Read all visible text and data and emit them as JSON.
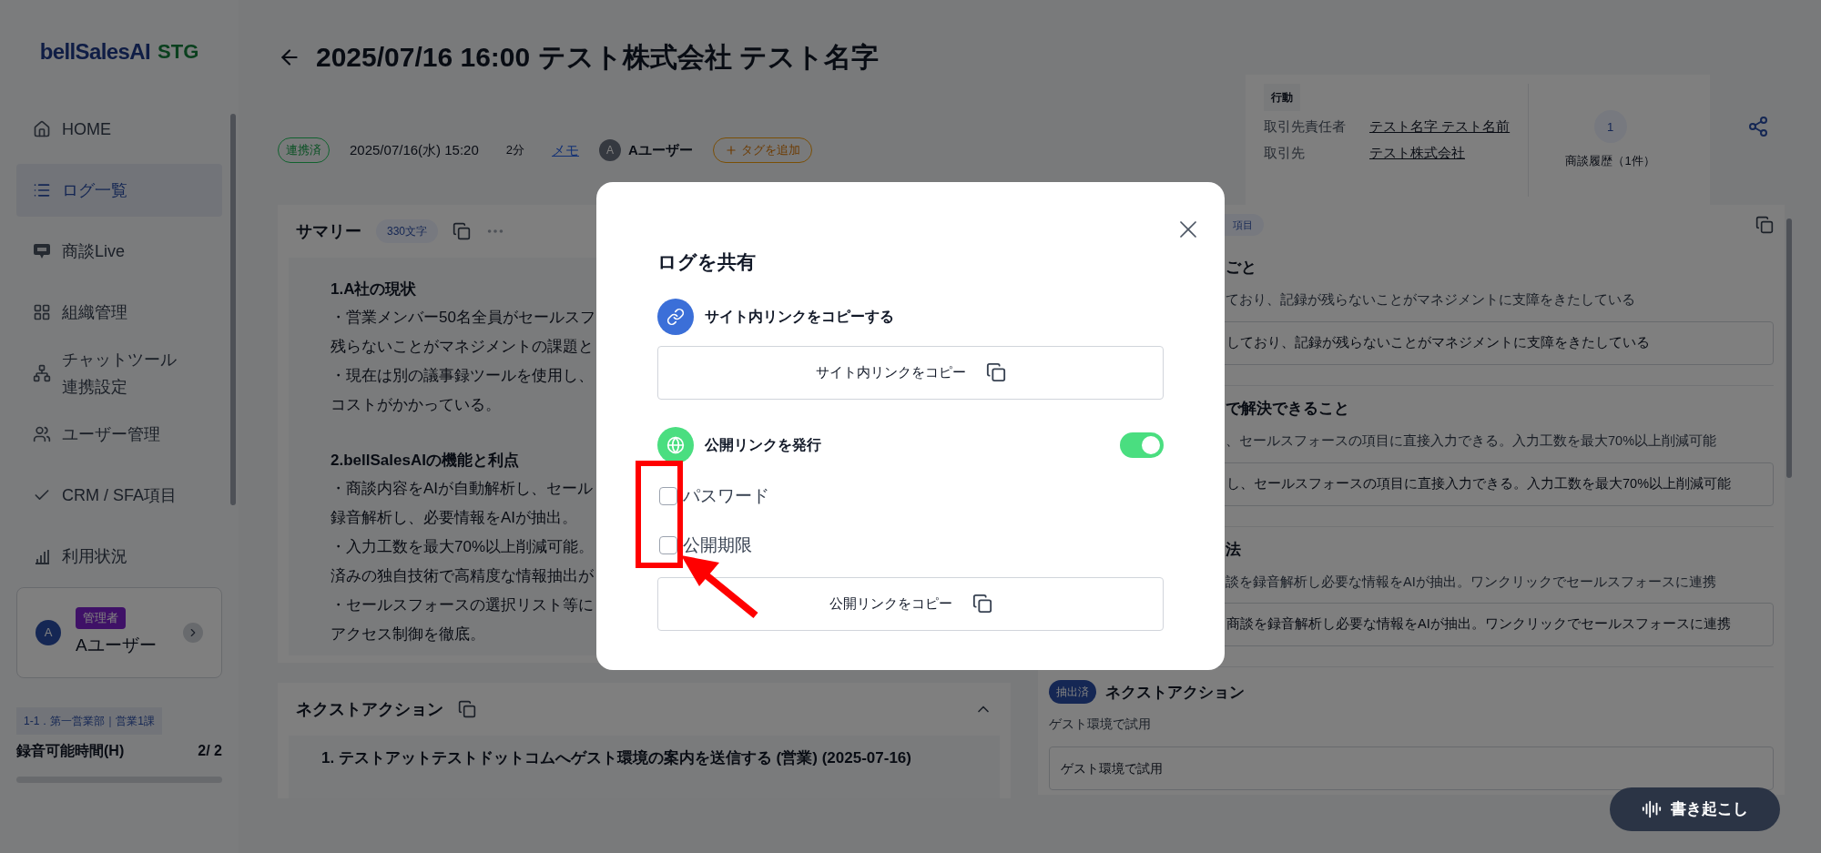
{
  "sidebar": {
    "logo": {
      "brand": "bellSalesAI",
      "env": "STG"
    },
    "nav": [
      {
        "label": "HOME",
        "selected": false
      },
      {
        "label": "ログ一覧",
        "selected": true
      },
      {
        "label": "商談Live",
        "selected": false
      },
      {
        "label": "組織管理",
        "selected": false
      },
      {
        "label": "チャットツール連携設定",
        "selected": false
      },
      {
        "label": "ユーザー管理",
        "selected": false
      },
      {
        "label": "CRM / SFA項目",
        "selected": false
      },
      {
        "label": "利用状況",
        "selected": false
      }
    ],
    "user": {
      "avatar": "A",
      "role": "管理者",
      "name": "Aユーザー"
    },
    "department": "1-1．第一営業部｜営業1課",
    "quota": {
      "label": "録音可能時間(H)",
      "value": "2/ 2"
    }
  },
  "header": {
    "title": "2025/07/16 16:00 テスト株式会社 テスト名字",
    "meta": {
      "status": "連携済",
      "datetime": "2025/07/16(水) 15:20",
      "duration": "2分",
      "memo": "メモ",
      "user_avatar": "A",
      "user": "Aユーザー",
      "add_tag": "タグを追加"
    },
    "info": {
      "tag": "行動",
      "rows": [
        {
          "label": "取引先責任者",
          "value": "テスト名字 テスト名前"
        },
        {
          "label": "取引先",
          "value": "テスト株式会社"
        }
      ],
      "history_count": "1",
      "history_label": "商談履歴（1件）"
    }
  },
  "summary": {
    "title": "サマリー",
    "count": "330文字",
    "lines": [
      {
        "kind": "heading",
        "text": "1.A社の現状"
      },
      {
        "kind": "text",
        "text": "・営業メンバー50名全員がセールスフ"
      },
      {
        "kind": "text",
        "text": "残らないことがマネジメントの課題と"
      },
      {
        "kind": "text",
        "text": "・現在は別の議事録ツールを使用し、"
      },
      {
        "kind": "text",
        "text": "コストがかかっている。"
      },
      {
        "kind": "gap"
      },
      {
        "kind": "heading",
        "text": "2.bellSalesAIの機能と利点"
      },
      {
        "kind": "text",
        "text": "・商談内容をAIが自動解析し、セール"
      },
      {
        "kind": "text",
        "text": "録音解析し、必要情報をAIが抽出。"
      },
      {
        "kind": "text",
        "text": "・入力工数を最大70%以上削減可能。"
      },
      {
        "kind": "text",
        "text": "済みの独自技術で高精度な情報抽出が"
      },
      {
        "kind": "text",
        "text": "・セールスフォースの選択リスト等に"
      },
      {
        "kind": "text",
        "text": "アクセス制御を徹底。"
      }
    ]
  },
  "next_action": {
    "title": "ネクストアクション",
    "items": [
      "1. テストアットテストドットコムへゲスト環境の案内を送信する (営業) (2025-07-16)"
    ]
  },
  "fields": {
    "tag": "項目",
    "sections": [
      {
        "title": "ごと",
        "text": "ており、記録が残らないことがマネジメントに支障をきたしている",
        "value": "しており、記録が残らないことがマネジメントに支障をきたしている"
      },
      {
        "title": "で解決できること",
        "text": "、セールスフォースの項目に直接入力できる。入力工数を最大70%以上削減可能",
        "value": "し、セールスフォースの項目に直接入力できる。入力工数を最大70%以上削減可能"
      },
      {
        "title": "法",
        "text": "談を録音解析し必要な情報をAIが抽出。ワンクリックでセールスフォースに連携",
        "value": "商談を録音解析し必要な情報をAIが抽出。ワンクリックでセールスフォースに連携"
      }
    ],
    "next": {
      "badge": "抽出済",
      "title": "ネクストアクション",
      "text": "ゲスト環境で試用",
      "value": "ゲスト環境で試用"
    }
  },
  "transcribe_button": "書き起こし",
  "modal": {
    "title": "ログを共有",
    "site_link": {
      "label": "サイト内リンクをコピーする",
      "button": "サイト内リンクをコピー"
    },
    "public_link": {
      "label": "公開リンクを発行",
      "on": true,
      "button": "公開リンクをコピー"
    },
    "options": [
      {
        "label": "パスワード",
        "checked": false
      },
      {
        "label": "公開期限",
        "checked": false
      }
    ]
  }
}
